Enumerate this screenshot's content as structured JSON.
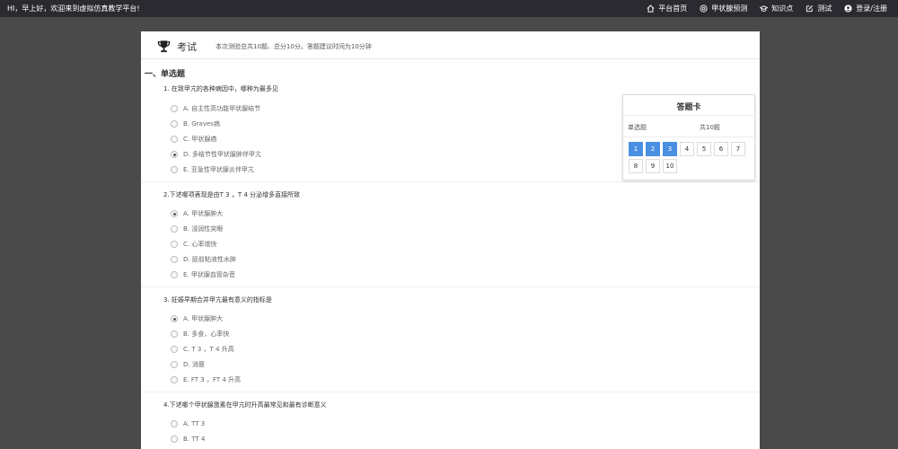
{
  "topbar": {
    "greeting": "HI，早上好，欢迎来到虚拟仿真教学平台!",
    "nav": [
      {
        "label": "平台首页",
        "icon": "home-icon"
      },
      {
        "label": "甲状腺预测",
        "icon": "target-icon"
      },
      {
        "label": "知识点",
        "icon": "graduation-cap-icon"
      },
      {
        "label": "测试",
        "icon": "edit-icon"
      },
      {
        "label": "登录/注册",
        "icon": "user-icon"
      }
    ]
  },
  "exam": {
    "title": "考试",
    "description": "本次测验总共10题、总分10分。答题建议时间为10分钟",
    "section_title": "一、单选题",
    "questions": [
      {
        "text": "1. 在致甲亢的各种病因中，哪种为最多见",
        "options": [
          "A. 自主性高功能甲状腺结节",
          "B. Graves病",
          "C. 甲状腺癌",
          "D. 多结节性甲状腺肿伴甲亢",
          "E. 亚急性甲状腺炎伴甲亢"
        ],
        "selected": 3
      },
      {
        "text": "2.下述哪项表现是由T 3 ，T 4 分泌增多直接所致",
        "options": [
          "A. 甲状腺肿大",
          "B. 浸润性突眼",
          "C. 心率增快",
          "D. 胫前粘液性水肿",
          "E. 甲状腺血管杂音"
        ],
        "selected": 0
      },
      {
        "text": "3. 妊娠早期合并甲亢最有意义的指标是",
        "options": [
          "A. 甲状腺肿大",
          "B. 多食，心率快",
          "C. T 3 ，T 4 升高",
          "D. 消瘦",
          "E. FT 3 ，FT 4 升高"
        ],
        "selected": 0
      },
      {
        "text": "4.下述哪个甲状腺激素在甲亢时升高最常见和最有诊断意义",
        "options": [
          "A. TT 3",
          "B. TT 4"
        ],
        "selected": -1
      }
    ]
  },
  "answer_card": {
    "title": "答题卡",
    "type_label": "单选题",
    "count_label": "共10题",
    "numbers": [
      "1",
      "2",
      "3",
      "4",
      "5",
      "6",
      "7",
      "8",
      "9",
      "10"
    ],
    "answered": [
      true,
      true,
      true,
      false,
      false,
      false,
      false,
      false,
      false,
      false
    ]
  }
}
